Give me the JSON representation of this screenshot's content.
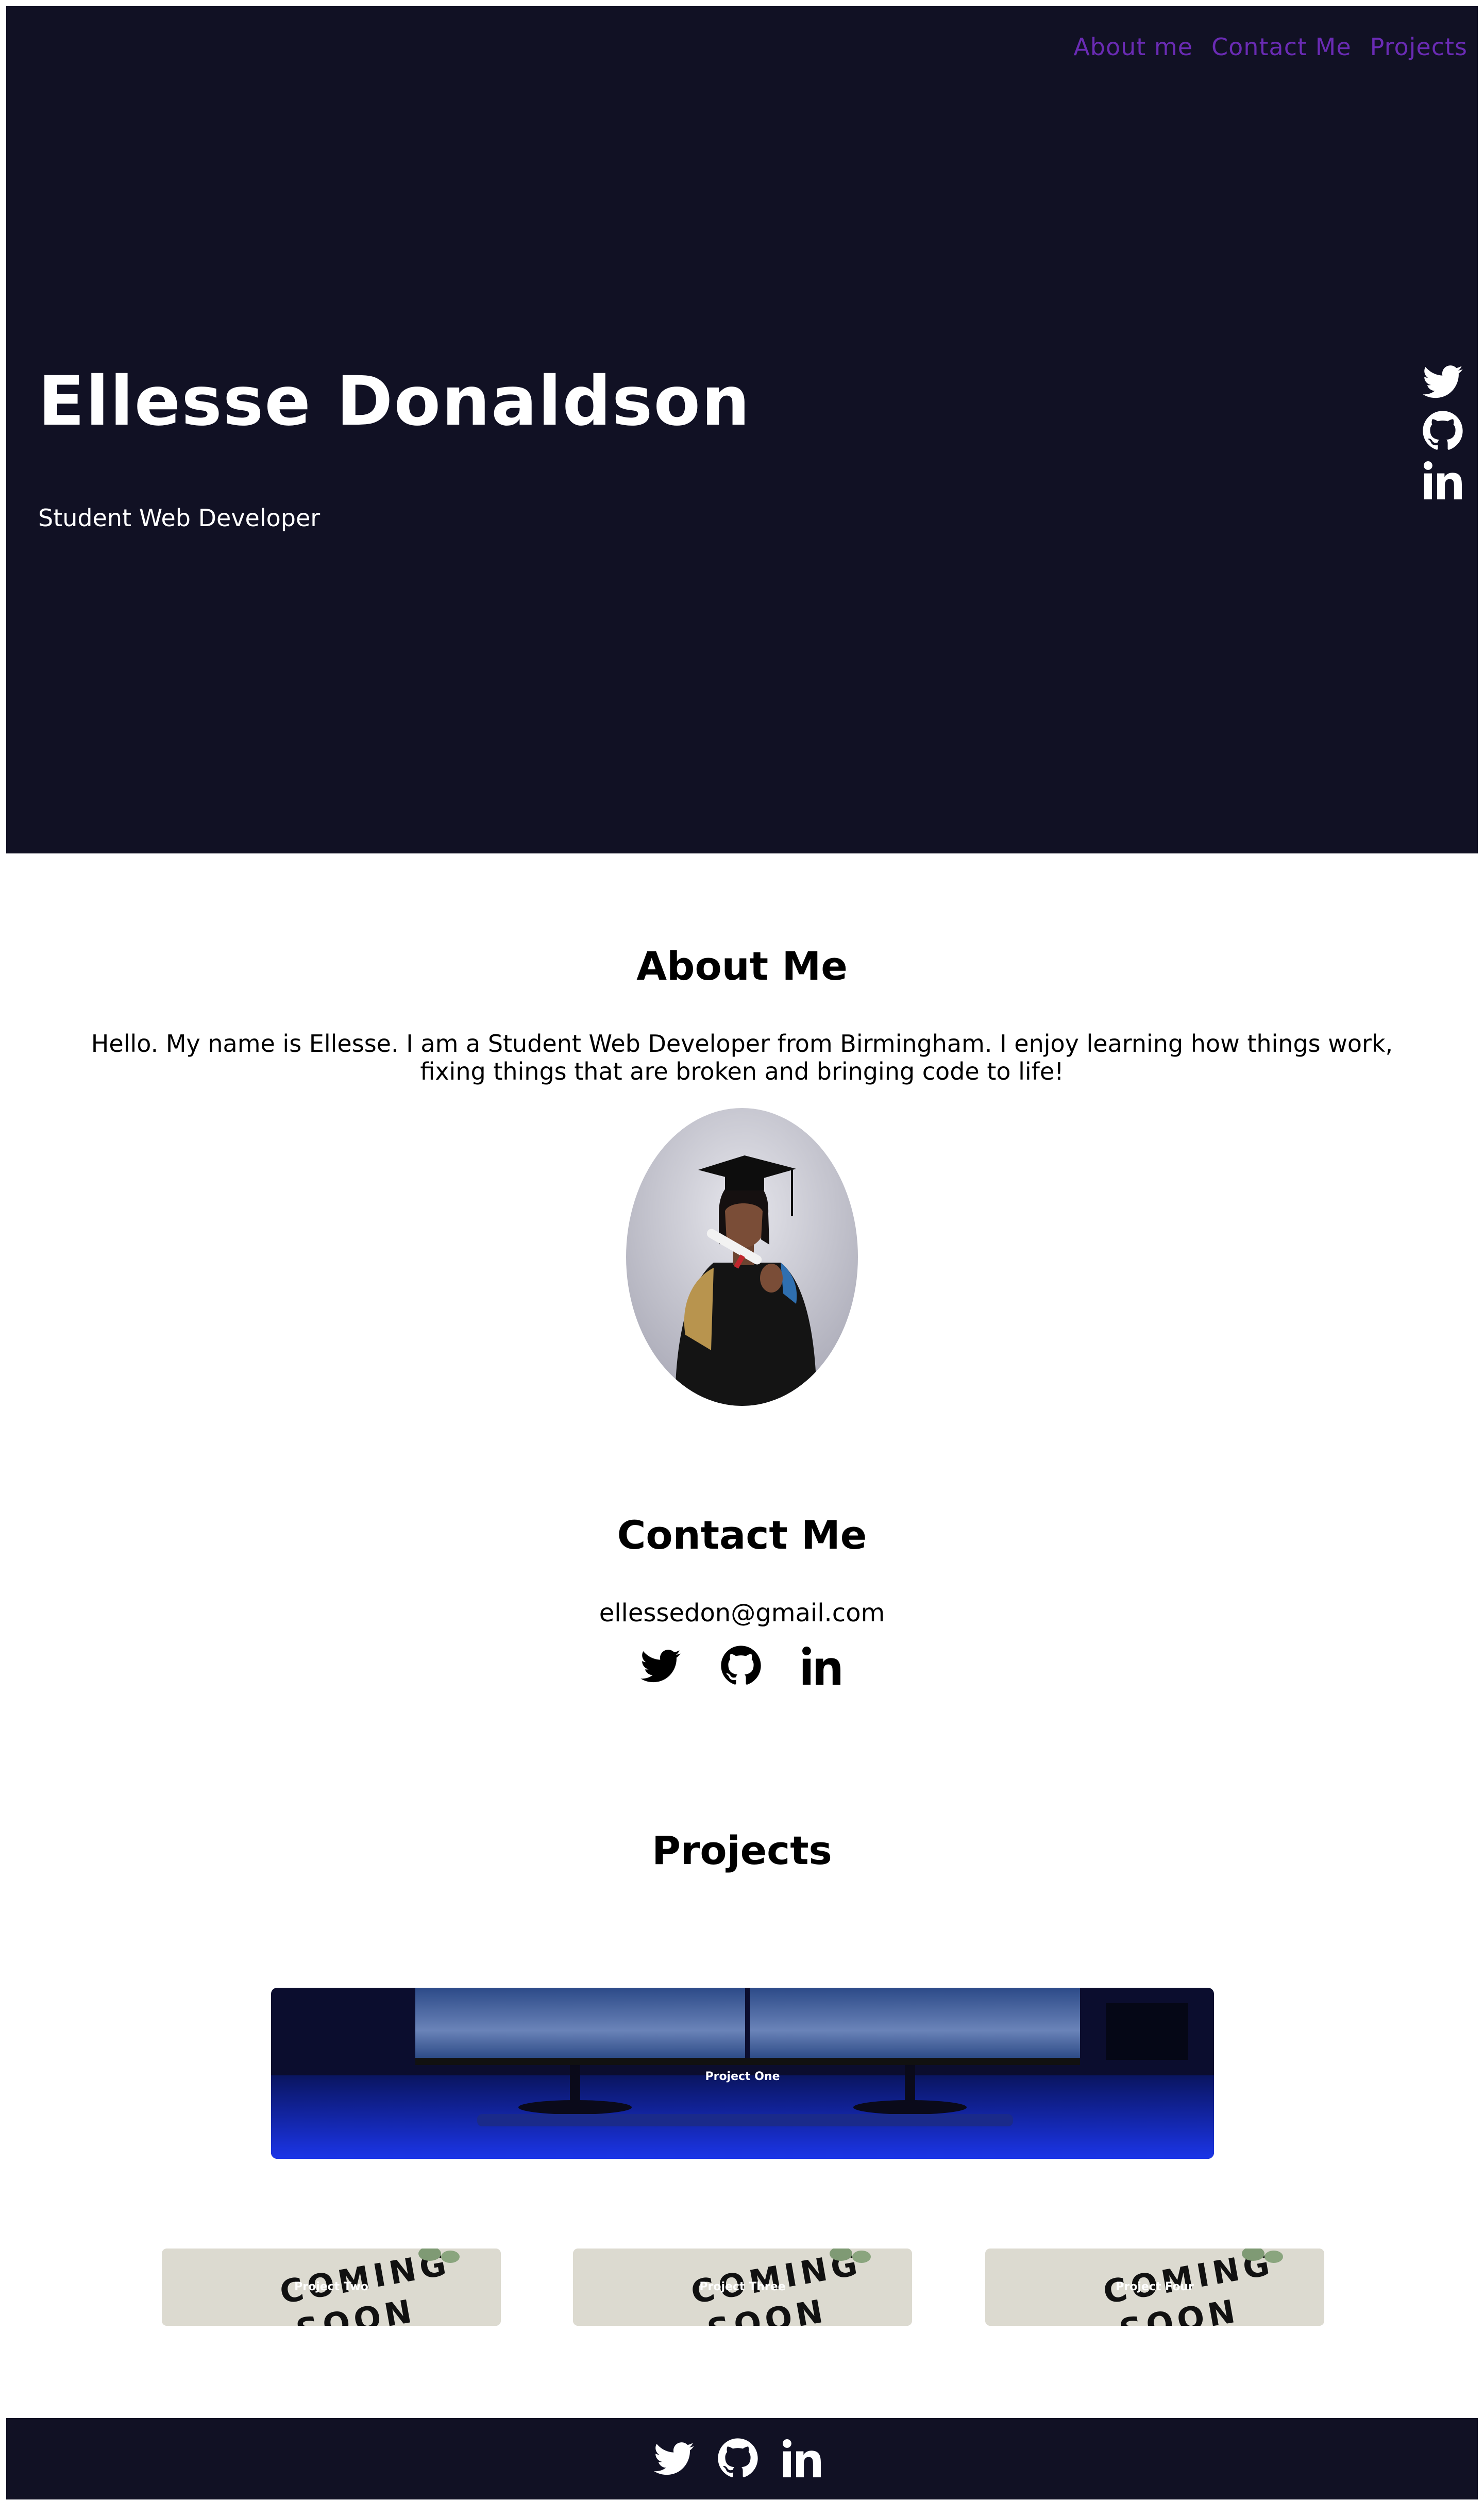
{
  "nav": {
    "about": "About me",
    "contact": "Contact Me",
    "projects": "Projects"
  },
  "hero": {
    "name": "Ellesse Donaldson",
    "subtitle": "Student Web Developer"
  },
  "about": {
    "title": "About Me",
    "text": "Hello. My name is Ellesse. I am a Student Web Developer from Birmingham. I enjoy learning how things work, fixing things that are broken and bringing code to life!"
  },
  "contact": {
    "title": "Contact Me",
    "email": "ellessedon@gmail.com"
  },
  "projects": {
    "title": "Projects",
    "items": [
      {
        "label": "Project One"
      },
      {
        "label": "Project Two"
      },
      {
        "label": "Project Three"
      },
      {
        "label": "Project Four"
      }
    ],
    "coming_soon": [
      "COMING",
      "SOON"
    ]
  },
  "icons": [
    "twitter-icon",
    "github-icon",
    "linkedin-icon"
  ],
  "colors": {
    "dark_bg": "#111124",
    "nav_link": "#6a2bb4",
    "text": "#000000",
    "white": "#ffffff"
  }
}
